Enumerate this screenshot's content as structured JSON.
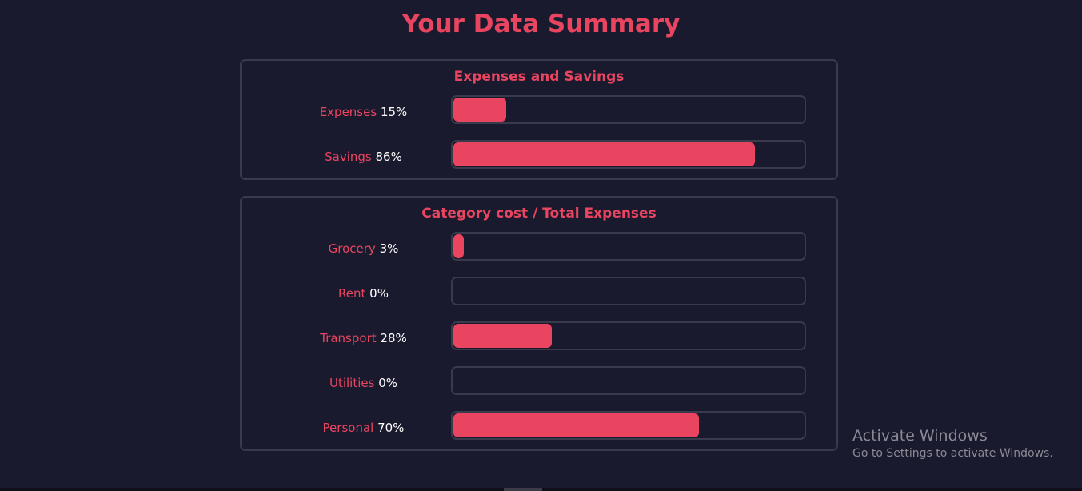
{
  "page": {
    "title": "Your Data Summary"
  },
  "expenses_savings": {
    "title": "Expenses and Savings",
    "rows": [
      {
        "name": "Expenses",
        "value_text": "15%",
        "value": 15
      },
      {
        "name": "Savings",
        "value_text": "86%",
        "value": 86
      }
    ]
  },
  "category_cost": {
    "title": "Category cost / Total Expenses",
    "rows": [
      {
        "name": "Grocery",
        "value_text": "3%",
        "value": 3
      },
      {
        "name": "Rent",
        "value_text": "0%",
        "value": 0
      },
      {
        "name": "Transport",
        "value_text": "28%",
        "value": 28
      },
      {
        "name": "Utilities",
        "value_text": "0%",
        "value": 0
      },
      {
        "name": "Personal",
        "value_text": "70%",
        "value": 70
      }
    ]
  },
  "watermark": {
    "title": "Activate Windows",
    "subtitle": "Go to Settings to activate Windows."
  },
  "colors": {
    "accent": "#e94560",
    "background": "#1a1a2e",
    "border": "#3a3a4d",
    "value_text": "#ffffff"
  }
}
